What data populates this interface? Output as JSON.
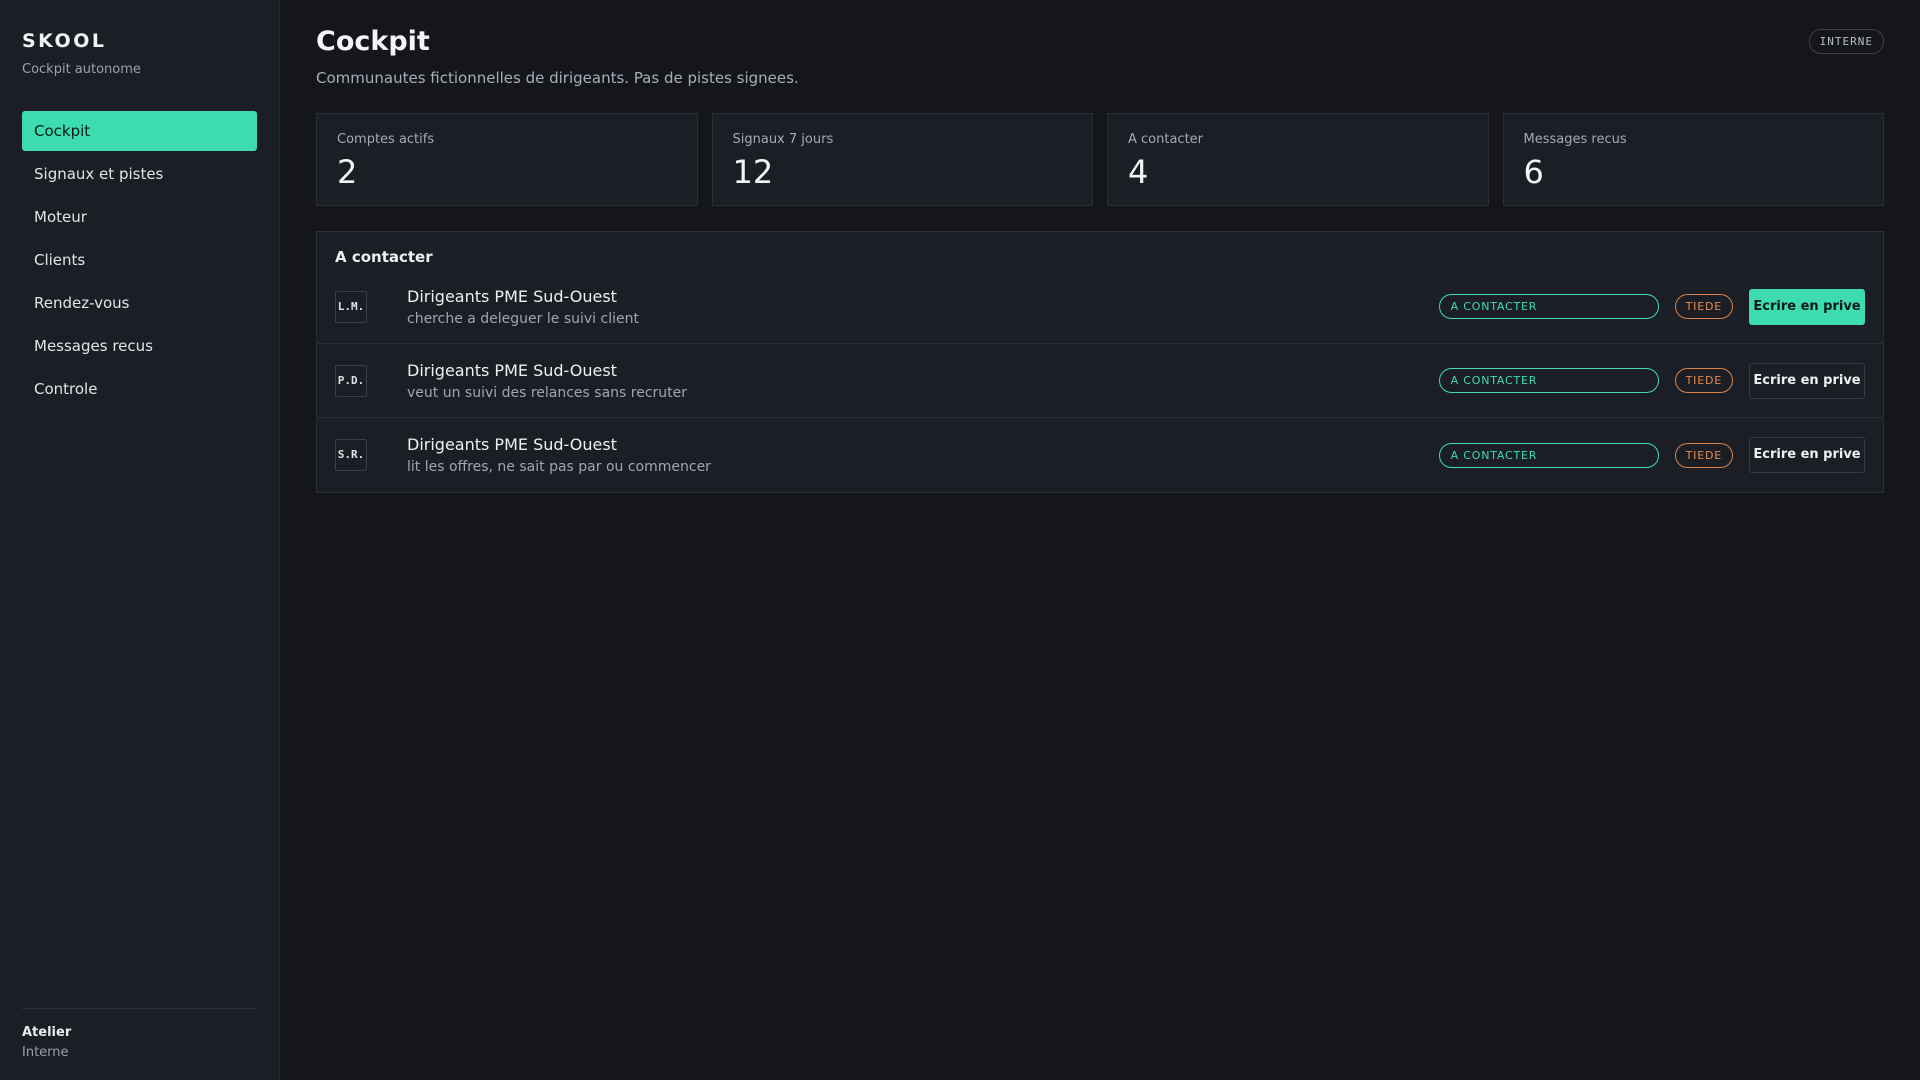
{
  "sidebar": {
    "brand_title": "SKOOL",
    "brand_subtitle": "Cockpit autonome",
    "items": [
      {
        "label": "Cockpit",
        "active": true
      },
      {
        "label": "Signaux et pistes"
      },
      {
        "label": "Moteur"
      },
      {
        "label": "Clients"
      },
      {
        "label": "Rendez-vous"
      },
      {
        "label": "Messages recus"
      },
      {
        "label": "Controle"
      }
    ],
    "footer": {
      "name": "Atelier",
      "role": "Interne"
    }
  },
  "header": {
    "title": "Cockpit",
    "subtitle": "Communautes fictionnelles de dirigeants. Pas de pistes signees.",
    "badge": "INTERNE"
  },
  "stats": [
    {
      "label": "Comptes actifs",
      "value": "2"
    },
    {
      "label": "Signaux 7 jours",
      "value": "12"
    },
    {
      "label": "A contacter",
      "value": "4"
    },
    {
      "label": "Messages recus",
      "value": "6"
    }
  ],
  "panel": {
    "title": "A contacter",
    "rows": [
      {
        "initials": "L.M.",
        "title": "Dirigeants PME Sud-Ouest",
        "desc": "cherche a deleguer le suivi client",
        "status": "A CONTACTER",
        "temp": "TIEDE",
        "action": "Ecrire en prive"
      },
      {
        "initials": "P.D.",
        "title": "Dirigeants PME Sud-Ouest",
        "desc": "veut un suivi des relances sans recruter",
        "status": "A CONTACTER",
        "temp": "TIEDE",
        "action": "Ecrire en prive"
      },
      {
        "initials": "S.R.",
        "title": "Dirigeants PME Sud-Ouest",
        "desc": "lit les offres, ne sait pas par ou commencer",
        "status": "A CONTACTER",
        "temp": "TIEDE",
        "action": "Ecrire en prive"
      }
    ]
  },
  "colors": {
    "accent": "#3ddcb0",
    "warm": "#e38c52",
    "background": "#14161b",
    "surface": "#1b1e25"
  }
}
